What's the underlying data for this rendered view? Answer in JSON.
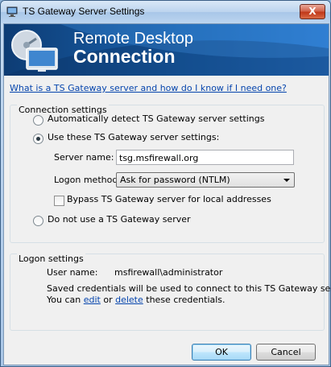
{
  "window": {
    "title": "TS Gateway Server Settings",
    "close_glyph": "X"
  },
  "banner": {
    "line1": "Remote Desktop",
    "line2": "Connection",
    "icon": "remote-desktop-computer-icon"
  },
  "help_link": "What is a TS Gateway server and how do I know if I need one?",
  "connection_settings": {
    "title": "Connection settings",
    "options": [
      {
        "label": "Automatically detect TS Gateway server settings",
        "checked": false
      },
      {
        "label": "Use these TS Gateway server settings:",
        "checked": true
      },
      {
        "label": "Do not use a TS Gateway server",
        "checked": false
      }
    ],
    "server_name_label": "Server name:",
    "server_name_value": "tsg.msfirewall.org",
    "logon_method_label": "Logon method:",
    "logon_method_value": "Ask for password (NTLM)",
    "bypass_label": "Bypass TS Gateway server for local addresses",
    "bypass_checked": false
  },
  "logon_settings": {
    "title": "Logon settings",
    "user_name_label": "User name:",
    "user_name_value": "msfirewall\\administrator",
    "credentials_line1": "Saved credentials will be used to connect to this TS Gateway server.",
    "credentials_prefix": "You can",
    "edit_link": "edit",
    "or_text": "or",
    "delete_link": "delete",
    "credentials_suffix": "these credentials."
  },
  "buttons": {
    "ok": "OK",
    "cancel": "Cancel"
  }
}
